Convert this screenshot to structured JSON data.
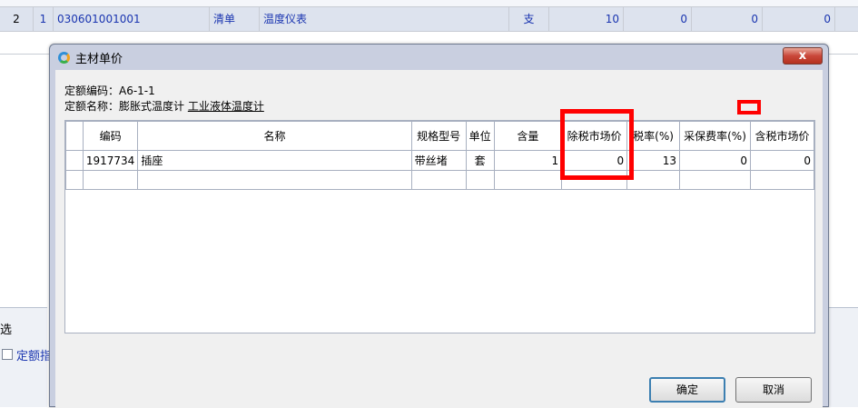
{
  "background_table": {
    "row": {
      "index": "2",
      "seq": "1",
      "code": "030601001001",
      "type": "清单",
      "name": "温度仪表",
      "unit": "支",
      "qty": "10",
      "v1": "0",
      "v2": "0",
      "v3": "0"
    }
  },
  "side": {
    "select_label": "选",
    "checkbox_label": "定额指"
  },
  "dialog": {
    "title": "主材单价",
    "close_label": "x",
    "quota_code_label": "定额编码：A6-1-1",
    "quota_name_prefix": "定额名称：膨胀式温度计 ",
    "quota_name_link": "工业液体温度计",
    "columns": [
      "编码",
      "名称",
      "规格型号",
      "单位",
      "含量",
      "除税市场价",
      "税率(%)",
      "采保费率(%)",
      "含税市场价"
    ],
    "rows": [
      {
        "code": "1917734",
        "name": "插座",
        "spec": "带丝堵",
        "unit": "套",
        "content": "1",
        "price_ex_tax": "0",
        "tax_rate": "13",
        "fee_rate": "0",
        "price_in_tax": "0"
      }
    ],
    "ok_label": "确定",
    "cancel_label": "取消"
  },
  "colors": {
    "highlight": "#ff0000",
    "link_blue": "#1a35b0"
  }
}
